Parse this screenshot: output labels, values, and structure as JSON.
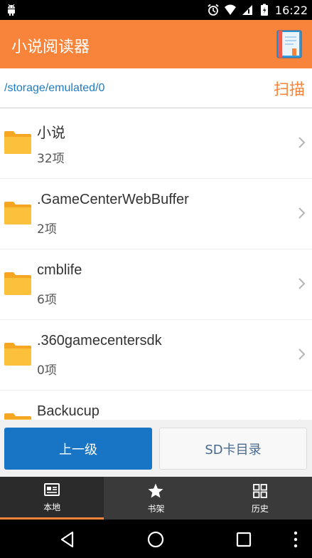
{
  "status_bar": {
    "time": "16:22",
    "icons": [
      "android-icon",
      "alarm-icon",
      "wifi-icon",
      "signal-icon",
      "battery-icon"
    ]
  },
  "app_bar": {
    "title": "小说阅读器",
    "action_icon": "book-icon"
  },
  "path_bar": {
    "path": "/storage/emulated/0",
    "scan_label": "扫描"
  },
  "files": [
    {
      "name": "小说",
      "count": "32项"
    },
    {
      "name": ".GameCenterWebBuffer",
      "count": "2项"
    },
    {
      "name": "cmblife",
      "count": "6项"
    },
    {
      "name": ".360gamecentersdk",
      "count": "0项"
    },
    {
      "name": "Backucup",
      "count": ""
    }
  ],
  "buttons": {
    "up_label": "上一级",
    "sd_label": "SD卡目录"
  },
  "tabs": [
    {
      "label": "本地",
      "icon": "local-icon",
      "active": true
    },
    {
      "label": "书架",
      "icon": "star-icon",
      "active": false
    },
    {
      "label": "历史",
      "icon": "history-icon",
      "active": false
    }
  ],
  "colors": {
    "accent": "#f7843a",
    "primary_button": "#1874c4",
    "path_text": "#1f7bc1",
    "folder": "#fbb829"
  }
}
